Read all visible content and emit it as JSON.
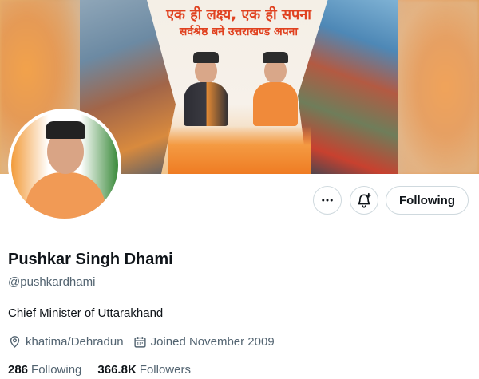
{
  "banner": {
    "headline_line1": "एक ही लक्ष्य, एक ही सपना",
    "headline_line2": "सर्वश्रेष्ठ बने उत्तराखण्ड अपना"
  },
  "actions": {
    "more_icon": "more-horizontal-icon",
    "notify_icon": "bell-plus-icon",
    "follow_label": "Following"
  },
  "profile": {
    "name": "Pushkar Singh Dhami",
    "handle": "@pushkardhami",
    "bio": "Chief Minister of Uttarakhand",
    "location": "khatima/Dehradun",
    "joined": "Joined November 2009"
  },
  "stats": {
    "following_count": "286",
    "following_label": "Following",
    "followers_count": "366.8K",
    "followers_label": "Followers"
  },
  "colors": {
    "text_primary": "#0f1419",
    "text_secondary": "#536471",
    "border": "#cfd9de",
    "headline_orange": "#e0411f"
  }
}
